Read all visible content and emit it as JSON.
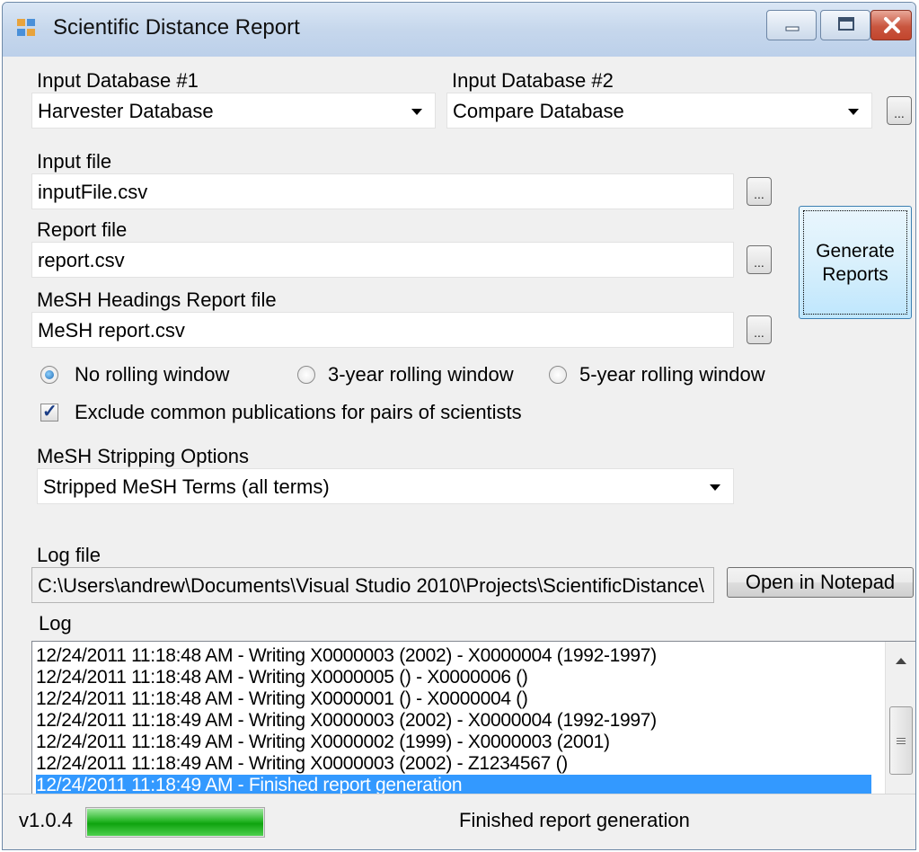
{
  "window": {
    "title": "Scientific Distance Report",
    "controls": [
      "minimize-icon",
      "maximize-icon",
      "close-icon"
    ]
  },
  "database1": {
    "label": "Input Database #1",
    "value": "Harvester Database"
  },
  "database2": {
    "label": "Input Database #2",
    "value": "Compare Database",
    "browse_label": "..."
  },
  "input_file": {
    "label": "Input file",
    "value": "inputFile.csv",
    "browse_label": "..."
  },
  "report_file": {
    "label": "Report file",
    "value": "report.csv",
    "browse_label": "..."
  },
  "mesh_report_file": {
    "label": "MeSH Headings Report file",
    "value": "MeSH report.csv",
    "browse_label": "..."
  },
  "generate_button": {
    "line1": "Generate",
    "line2": "Reports"
  },
  "rolling_window": {
    "options": [
      "No rolling window",
      "3-year rolling window",
      "5-year rolling window"
    ],
    "selected": "No rolling window"
  },
  "exclude_common": {
    "label": "Exclude common publications for pairs of scientists",
    "checked": true
  },
  "mesh_stripping": {
    "label": "MeSH Stripping Options",
    "value": "Stripped MeSH Terms (all terms)"
  },
  "log_file": {
    "label": "Log file",
    "value": "C:\\Users\\andrew\\Documents\\Visual Studio 2010\\Projects\\ScientificDistance\\",
    "open_button": "Open in Notepad"
  },
  "log": {
    "label": "Log",
    "lines": [
      "12/24/2011 11:18:48 AM - Writing X0000003 (2002) - X0000004 (1992-1997)",
      "12/24/2011 11:18:48 AM - Writing X0000005 () - X0000006 ()",
      "12/24/2011 11:18:48 AM - Writing X0000001 () - X0000004 ()",
      "12/24/2011 11:18:49 AM - Writing X0000003 (2002) - X0000004 (1992-1997)",
      "12/24/2011 11:18:49 AM - Writing X0000002 (1999) - X0000003 (2001)",
      "12/24/2011 11:18:49 AM - Writing X0000003 (2002) - Z1234567 ()",
      "12/24/2011 11:18:49 AM - Finished report generation"
    ],
    "selected_index": 6
  },
  "status": {
    "version": "v1.0.4",
    "progress_percent": 100,
    "message": "Finished report generation"
  }
}
